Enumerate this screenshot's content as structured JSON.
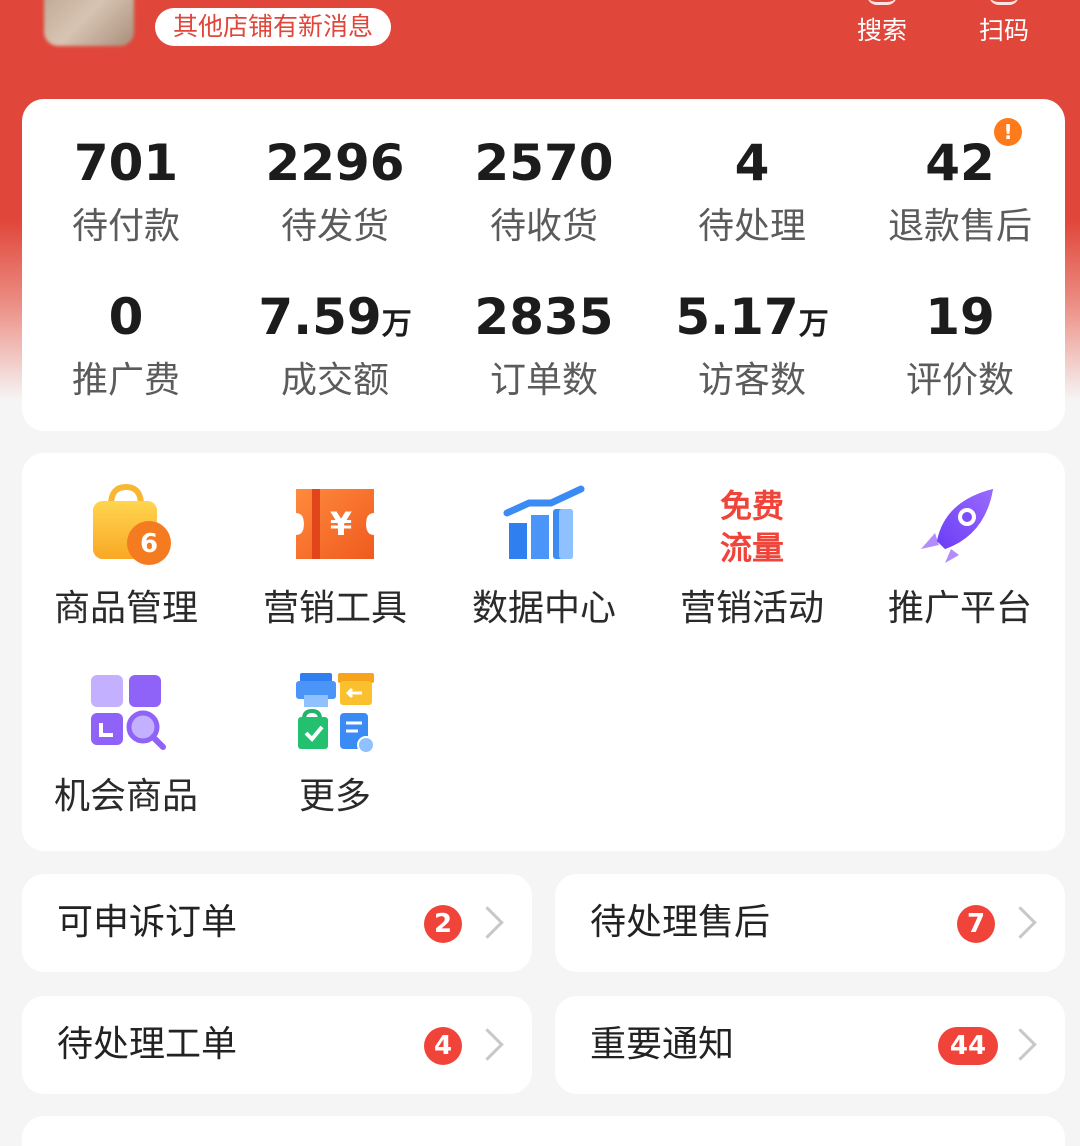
{
  "header": {
    "notice": "其他店铺有新消息",
    "search_label": "搜索",
    "scan_label": "扫码"
  },
  "stats": [
    {
      "value": "701",
      "unit": "",
      "label": "待付款"
    },
    {
      "value": "2296",
      "unit": "",
      "label": "待发货"
    },
    {
      "value": "2570",
      "unit": "",
      "label": "待收货"
    },
    {
      "value": "4",
      "unit": "",
      "label": "待处理"
    },
    {
      "value": "42",
      "unit": "",
      "label": "退款售后",
      "alert": "!"
    },
    {
      "value": "0",
      "unit": "",
      "label": "推广费"
    },
    {
      "value": "7.59",
      "unit": "万",
      "label": "成交额"
    },
    {
      "value": "2835",
      "unit": "",
      "label": "订单数"
    },
    {
      "value": "5.17",
      "unit": "万",
      "label": "访客数"
    },
    {
      "value": "19",
      "unit": "",
      "label": "评价数"
    }
  ],
  "tools": [
    {
      "label": "商品管理",
      "icon": "shopping-bag-icon",
      "badge": "6"
    },
    {
      "label": "营销工具",
      "icon": "coupon-icon",
      "glyph": "¥"
    },
    {
      "label": "数据中心",
      "icon": "bar-chart-icon"
    },
    {
      "label": "营销活动",
      "icon": "free-traffic-icon",
      "line1": "免费",
      "line2": "流量"
    },
    {
      "label": "推广平台",
      "icon": "rocket-icon"
    },
    {
      "label": "机会商品",
      "icon": "product-search-icon"
    },
    {
      "label": "更多",
      "icon": "more-services-icon"
    }
  ],
  "todos": [
    {
      "label": "可申诉订单",
      "count": "2"
    },
    {
      "label": "待处理售后",
      "count": "7"
    },
    {
      "label": "待处理工单",
      "count": "4"
    },
    {
      "label": "重要通知",
      "count": "44"
    }
  ],
  "colors": {
    "brand_red": "#e0463a",
    "badge_red": "#f0443a",
    "alert_orange": "#ff7a1a"
  }
}
